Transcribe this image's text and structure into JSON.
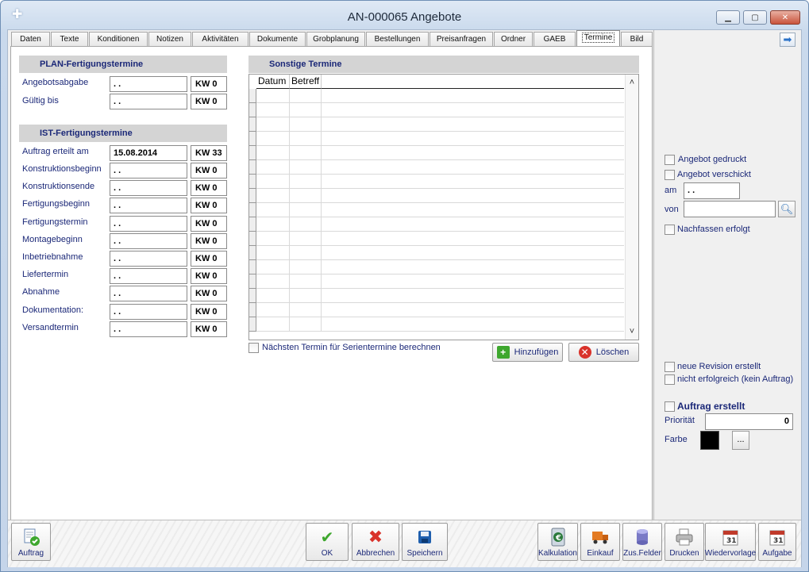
{
  "window": {
    "title": "AN-000065 Angebote",
    "minimize": "▁",
    "maximize": "▢",
    "close": "✕"
  },
  "tabs": [
    {
      "label": "Daten"
    },
    {
      "label": "Texte"
    },
    {
      "label": "Konditionen"
    },
    {
      "label": "Notizen"
    },
    {
      "label": "Aktivitäten"
    },
    {
      "label": "Dokumente"
    },
    {
      "label": "Grobplanung"
    },
    {
      "label": "Bestellungen"
    },
    {
      "label": "Preisanfragen"
    },
    {
      "label": "Ordner"
    },
    {
      "label": "GAEB"
    },
    {
      "label": "Termine"
    },
    {
      "label": "Bild"
    }
  ],
  "active_tab": "Termine",
  "plan": {
    "header": "PLAN-Fertigungstermine",
    "rows": [
      {
        "label": "Angebotsabgabe",
        "date": " . .",
        "kw": "KW 0"
      },
      {
        "label": "Gültig bis",
        "date": " . .",
        "kw": "KW 0"
      }
    ]
  },
  "ist": {
    "header": "IST-Fertigungstermine",
    "rows": [
      {
        "label": "Auftrag erteilt am",
        "date": "15.08.2014",
        "kw": "KW 33"
      },
      {
        "label": "Konstruktionsbeginn",
        "date": " . .",
        "kw": "KW 0"
      },
      {
        "label": "Konstruktionsende",
        "date": " . .",
        "kw": "KW 0"
      },
      {
        "label": "Fertigungsbeginn",
        "date": " . .",
        "kw": "KW 0"
      },
      {
        "label": "Fertigungstermin",
        "date": " . .",
        "kw": "KW 0"
      },
      {
        "label": "Montagebeginn",
        "date": " . .",
        "kw": "KW 0"
      },
      {
        "label": "Inbetriebnahme",
        "date": " . .",
        "kw": "KW 0"
      },
      {
        "label": "Liefertermin",
        "date": " . .",
        "kw": "KW 0"
      },
      {
        "label": "Abnahme",
        "date": " . .",
        "kw": "KW 0"
      },
      {
        "label": "Dokumentation:",
        "date": " . .",
        "kw": "KW 0"
      },
      {
        "label": "Versandtermin",
        "date": " . .",
        "kw": "KW 0"
      }
    ]
  },
  "sonstige": {
    "header": "Sonstige Termine",
    "columns": [
      "Datum",
      "Betreff"
    ],
    "serien_label": "Nächsten Termin für Serientermine berechnen",
    "add_label": "Hinzufügen",
    "delete_label": "Löschen",
    "scroll_up": "˄",
    "scroll_down": "˅"
  },
  "right": {
    "arrow": "➡",
    "gedruckt": "Angebot gedruckt",
    "verschickt": "Angebot verschickt",
    "am_label": "am",
    "am_value": " . .",
    "von_label": "von",
    "von_value": "",
    "nachfassen": "Nachfassen erfolgt",
    "revision": "neue Revision erstellt",
    "nicht_erfolgreich": "nicht erfolgreich (kein Auftrag)",
    "auftrag_erstellt": "Auftrag erstellt",
    "prioritaet_label": "Priorität",
    "prioritaet_value": "0",
    "farbe_label": "Farbe",
    "farbe_value": "#000000",
    "farbe_button": "..."
  },
  "toolbar": {
    "auftrag": "Auftrag",
    "ok": "OK",
    "abbrechen": "Abbrechen",
    "speichern": "Speichern",
    "kalkulation": "Kalkulation",
    "einkauf": "Einkauf",
    "zusfelder": "Zus.Felder",
    "drucken": "Drucken",
    "wiedervorlage": "Wiedervorlage",
    "aufgabe": "Aufgabe"
  },
  "colors": {
    "label_blue": "#1b2878",
    "header_gray": "#d4d4d4",
    "ok_green": "#3ea72e",
    "cancel_red": "#d9322a",
    "save_blue": "#1f5fae"
  }
}
